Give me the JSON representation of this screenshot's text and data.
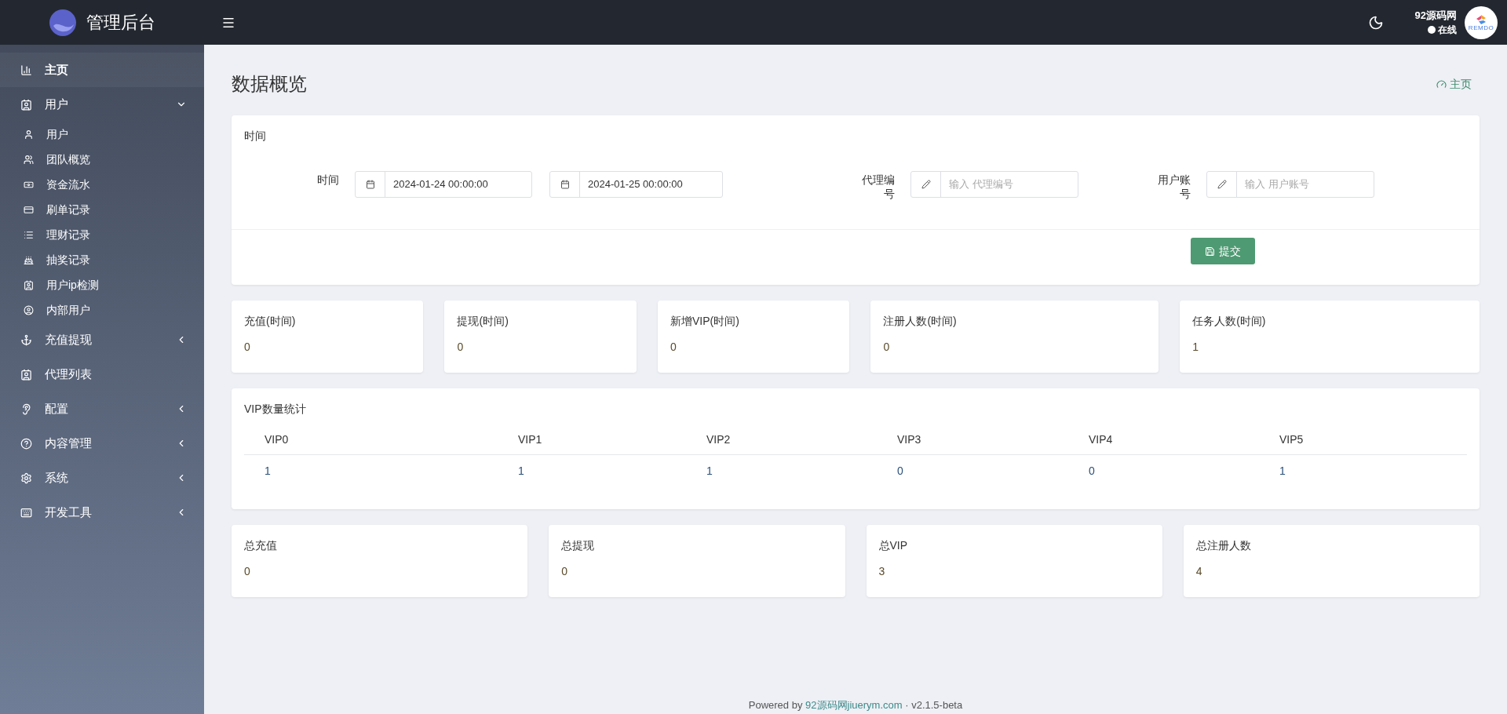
{
  "brand": {
    "title": "管理后台"
  },
  "sidebar": {
    "items": [
      {
        "label": "主页",
        "kind": "chart",
        "selected": true
      },
      {
        "label": "用户",
        "kind": "contact",
        "selected": false,
        "expanded": true,
        "children": [
          {
            "label": "用户",
            "kind": "user",
            "selected": false
          },
          {
            "label": "团队概览",
            "kind": "users",
            "selected": false
          },
          {
            "label": "资金流水",
            "kind": "money",
            "selected": false
          },
          {
            "label": "刷单记录",
            "kind": "card",
            "selected": false
          },
          {
            "label": "理财记录",
            "kind": "list",
            "selected": false
          },
          {
            "label": "抽奖记录",
            "kind": "cake",
            "selected": false
          },
          {
            "label": "用户ip检测",
            "kind": "contact",
            "selected": false
          },
          {
            "label": "内部用户",
            "kind": "usercircle",
            "selected": false
          }
        ]
      },
      {
        "label": "充值提现",
        "kind": "anchor",
        "selected": false,
        "expanded": false
      },
      {
        "label": "代理列表",
        "kind": "contact",
        "selected": false
      },
      {
        "label": "配置",
        "kind": "ear",
        "selected": false,
        "expanded": false
      },
      {
        "label": "内容管理",
        "kind": "help",
        "selected": false,
        "expanded": false
      },
      {
        "label": "系统",
        "kind": "gear",
        "selected": false,
        "expanded": false
      },
      {
        "label": "开发工具",
        "kind": "keyboard",
        "selected": false,
        "expanded": false
      }
    ]
  },
  "header": {
    "site_name": "92源码网",
    "status": "在线",
    "avatar_text": "REMDO"
  },
  "page": {
    "title": "数据概览",
    "breadcrumb": "主页"
  },
  "filter_card": {
    "title": "时间",
    "filters": [
      {
        "label": "时间",
        "inputs": [
          {
            "kind": "date",
            "value": "2024-01-24 00:00:00"
          },
          {
            "kind": "date",
            "value": "2024-01-25 00:00:00"
          }
        ]
      },
      {
        "label": "代理编号",
        "inputs": [
          {
            "kind": "text",
            "placeholder": "输入 代理编号"
          }
        ]
      },
      {
        "label": "用户账号",
        "inputs": [
          {
            "kind": "text",
            "placeholder": "输入 用户账号"
          }
        ]
      }
    ],
    "submit": "提交"
  },
  "period_stats": [
    {
      "label": "充值(时间)",
      "value": "0"
    },
    {
      "label": "提现(时间)",
      "value": "0"
    },
    {
      "label": "新增VIP(时间)",
      "value": "0"
    },
    {
      "label": "注册人数(时间)",
      "value": "0"
    },
    {
      "label": "任务人数(时间)",
      "value": "1"
    }
  ],
  "vip_table": {
    "title": "VIP数量统计",
    "columns": [
      "VIP0",
      "VIP1",
      "VIP2",
      "VIP3",
      "VIP4",
      "VIP5"
    ],
    "values": [
      "1",
      "1",
      "1",
      "0",
      "0",
      "1"
    ]
  },
  "total_stats": [
    {
      "label": "总充值",
      "value": "0"
    },
    {
      "label": "总提现",
      "value": "0"
    },
    {
      "label": "总VIP",
      "value": "3"
    },
    {
      "label": "总注册人数",
      "value": "4"
    }
  ],
  "footer": {
    "prefix": "Powered by",
    "link": "92源码网jiuerym.com",
    "separator": "·",
    "version": "v2.1.5-beta"
  }
}
